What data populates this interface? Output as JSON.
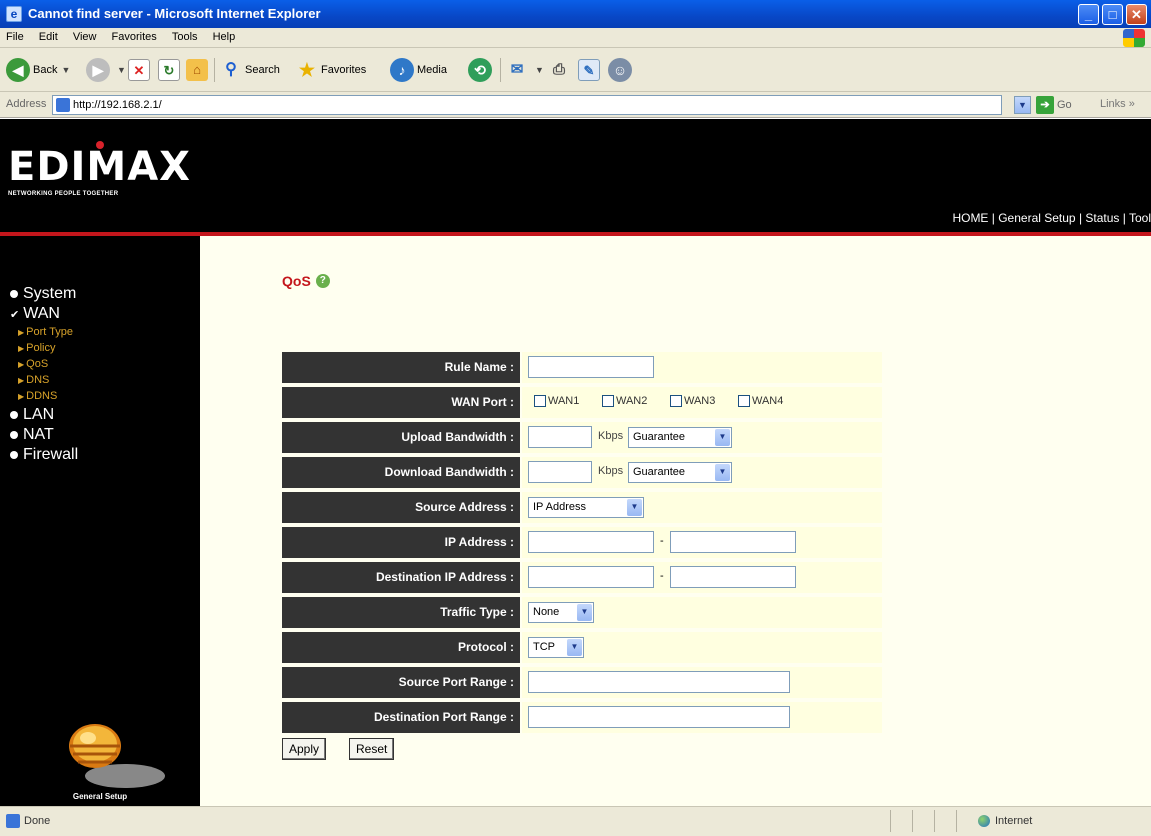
{
  "window": {
    "title": "Cannot find server - Microsoft Internet Explorer"
  },
  "menu": [
    "File",
    "Edit",
    "View",
    "Favorites",
    "Tools",
    "Help"
  ],
  "toolbar": {
    "back": "Back",
    "search": "Search",
    "favorites": "Favorites",
    "media": "Media"
  },
  "address": {
    "label": "Address",
    "url": "http://192.168.2.1/",
    "go": "Go",
    "links": "Links"
  },
  "banner": {
    "logo": "EDIMAX",
    "tagline": "NETWORKING PEOPLE TOGETHER",
    "nav": "HOME | General Setup | Status | Tool"
  },
  "sidebar": {
    "items": [
      "System",
      "WAN",
      "LAN",
      "NAT",
      "Firewall"
    ],
    "wan_subitems": [
      "Port Type",
      "Policy",
      "QoS",
      "DNS",
      "DDNS"
    ],
    "footer": "General Setup"
  },
  "page": {
    "heading": "QoS"
  },
  "form": {
    "rule_name": {
      "label": "Rule Name :",
      "value": ""
    },
    "wan_port": {
      "label": "WAN Port :",
      "options": [
        "WAN1",
        "WAN2",
        "WAN3",
        "WAN4"
      ]
    },
    "upload": {
      "label": "Upload Bandwidth :",
      "value": "",
      "unit": "Kbps",
      "mode": "Guarantee"
    },
    "download": {
      "label": "Download Bandwidth :",
      "value": "",
      "unit": "Kbps",
      "mode": "Guarantee"
    },
    "source_address": {
      "label": "Source Address :",
      "selected": "IP Address"
    },
    "ip_address": {
      "label": "IP Address :",
      "start": "",
      "end": ""
    },
    "destination_ip": {
      "label": "Destination IP Address :",
      "start": "",
      "end": ""
    },
    "traffic_type": {
      "label": "Traffic Type :",
      "selected": "None"
    },
    "protocol": {
      "label": "Protocol :",
      "selected": "TCP"
    },
    "source_port": {
      "label": "Source Port Range :",
      "value": ""
    },
    "destination_port": {
      "label": "Destination Port Range :",
      "value": ""
    },
    "apply": "Apply",
    "reset": "Reset"
  },
  "status": {
    "text": "Done",
    "zone": "Internet"
  },
  "colors": {
    "accent_red": "#c4161c",
    "form_label_bg": "#333333",
    "form_cell_bg": "#ffffe0",
    "sub_item": "#d7a22a"
  }
}
